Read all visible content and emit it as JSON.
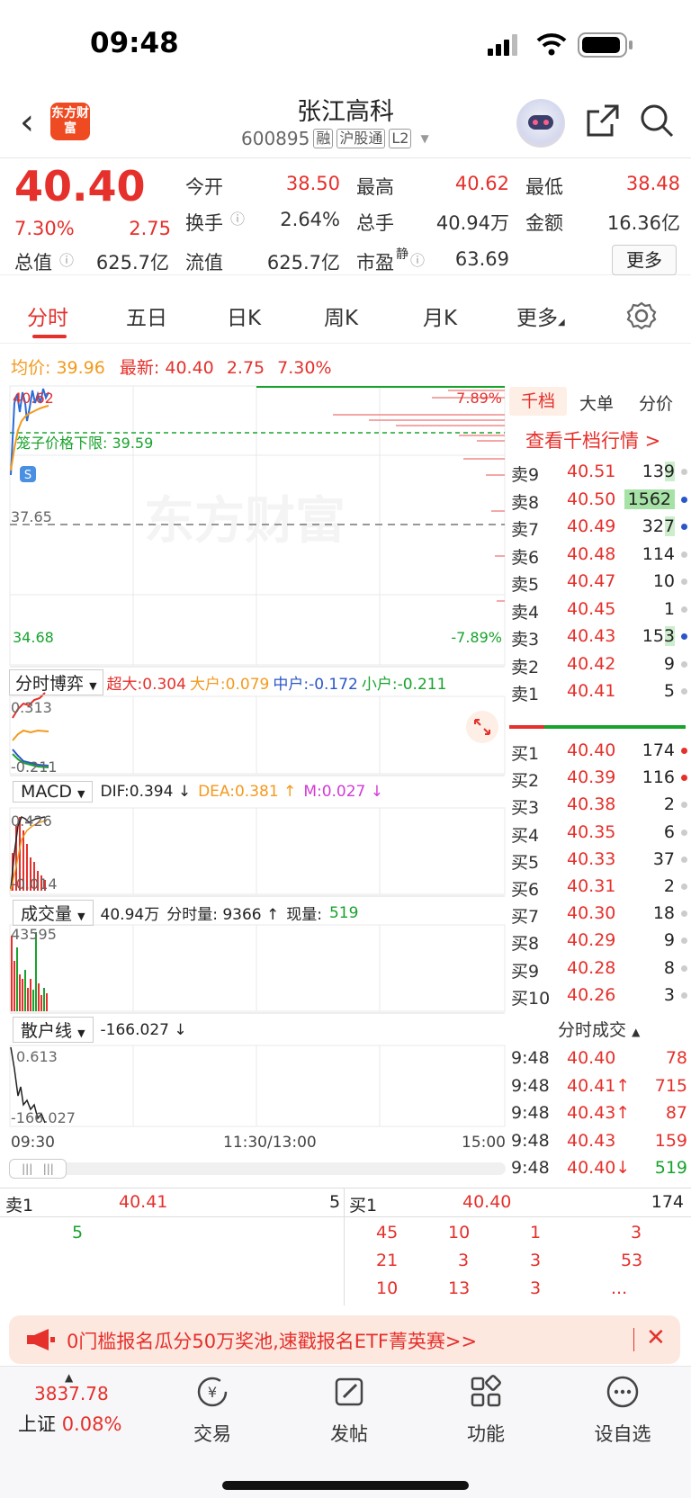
{
  "status_bar": {
    "time": "09:48"
  },
  "header": {
    "logo_text": "东方财富",
    "stock_name": "张江高科",
    "stock_code": "600895",
    "tags": [
      "融",
      "沪股通",
      "L2"
    ]
  },
  "quote": {
    "price": "40.40",
    "change_pct": "7.30%",
    "change": "2.75",
    "fields": [
      {
        "label": "今开",
        "value": "38.50",
        "color": "red"
      },
      {
        "label": "最高",
        "value": "40.62",
        "color": "red"
      },
      {
        "label": "最低",
        "value": "38.48",
        "color": "red"
      },
      {
        "label": "换手",
        "value": "2.64%",
        "color": "dark"
      },
      {
        "label": "总手",
        "value": "40.94万",
        "color": "dark"
      },
      {
        "label": "金额",
        "value": "16.36亿",
        "color": "dark"
      },
      {
        "label": "总值",
        "value": "625.7亿",
        "color": "dark"
      },
      {
        "label": "流值",
        "value": "625.7亿",
        "color": "dark"
      },
      {
        "label": "市盈",
        "value": "63.69",
        "color": "dark"
      }
    ],
    "pe_sup": "静",
    "more_label": "更多"
  },
  "tabs": [
    "分时",
    "五日",
    "日K",
    "周K",
    "月K",
    "更多"
  ],
  "avg_line": {
    "avg_label": "均价:",
    "avg_value": "39.96",
    "latest_label": "最新:",
    "latest_value": "40.40",
    "change": "2.75",
    "change_pct": "7.30%"
  },
  "main_chart": {
    "high_label": "40.62",
    "low_label": "34.68",
    "mid_label": "37.65",
    "up_pct": "7.89%",
    "down_pct": "-7.89%",
    "limit_label": "笼子价格下限: 39.59",
    "s_marker": "S",
    "watermark": "东方财富"
  },
  "capital": {
    "title": "分时博弈",
    "items": [
      {
        "label": "超大:0.304",
        "color": "#e5302b"
      },
      {
        "label": "大户:0.079",
        "color": "#f39a1e"
      },
      {
        "label": "中户:-0.172",
        "color": "#2b56c8"
      },
      {
        "label": "小户:-0.211",
        "color": "#18a32d"
      }
    ],
    "top": "0.313",
    "bottom": "-0.211"
  },
  "macd": {
    "title": "MACD",
    "dif": "DIF:0.394 ↓",
    "dea": "DEA:0.381 ↑",
    "m": "M:0.027 ↓",
    "top": "0.426",
    "bottom": "-0.014"
  },
  "volume": {
    "title": "成交量",
    "total": "40.94万",
    "label": "分时量: 9366 ↑",
    "now_label": "现量:",
    "now_value": "519",
    "top": "43595"
  },
  "retail": {
    "title": "散户线",
    "value": "-166.027 ↓",
    "top": "0.613",
    "bottom": "-166.027"
  },
  "time_axis": [
    "09:30",
    "11:30/13:00",
    "15:00"
  ],
  "orderbook": {
    "tabs": [
      "千档",
      "大单",
      "分价"
    ],
    "link": "查看千档行情 >",
    "asks": [
      {
        "label": "卖9",
        "price": "40.51",
        "vol": "139",
        "dot": "#ccc"
      },
      {
        "label": "卖8",
        "price": "40.50",
        "vol": "1562",
        "dot": "#2b56c8"
      },
      {
        "label": "卖7",
        "price": "40.49",
        "vol": "327",
        "dot": "#2b56c8"
      },
      {
        "label": "卖6",
        "price": "40.48",
        "vol": "114",
        "dot": "#ccc"
      },
      {
        "label": "卖5",
        "price": "40.47",
        "vol": "10",
        "dot": "#ccc"
      },
      {
        "label": "卖4",
        "price": "40.45",
        "vol": "1",
        "dot": "#ccc"
      },
      {
        "label": "卖3",
        "price": "40.43",
        "vol": "153",
        "dot": "#2b56c8"
      },
      {
        "label": "卖2",
        "price": "40.42",
        "vol": "9",
        "dot": "#ccc"
      },
      {
        "label": "卖1",
        "price": "40.41",
        "vol": "5",
        "dot": "#ccc"
      }
    ],
    "bids": [
      {
        "label": "买1",
        "price": "40.40",
        "vol": "174",
        "dot": "#e5302b"
      },
      {
        "label": "买2",
        "price": "40.39",
        "vol": "116",
        "dot": "#e5302b"
      },
      {
        "label": "买3",
        "price": "40.38",
        "vol": "2",
        "dot": "#ccc"
      },
      {
        "label": "买4",
        "price": "40.35",
        "vol": "6",
        "dot": "#ccc"
      },
      {
        "label": "买5",
        "price": "40.33",
        "vol": "37",
        "dot": "#ccc"
      },
      {
        "label": "买6",
        "price": "40.31",
        "vol": "2",
        "dot": "#ccc"
      },
      {
        "label": "买7",
        "price": "40.30",
        "vol": "18",
        "dot": "#ccc"
      },
      {
        "label": "买8",
        "price": "40.29",
        "vol": "9",
        "dot": "#ccc"
      },
      {
        "label": "买9",
        "price": "40.28",
        "vol": "8",
        "dot": "#ccc"
      },
      {
        "label": "买10",
        "price": "40.26",
        "vol": "3",
        "dot": "#ccc"
      }
    ],
    "trades_title": "分时成交",
    "trades": [
      {
        "time": "9:48",
        "price": "40.40",
        "vol": "78",
        "pc": "red",
        "vc": "red"
      },
      {
        "time": "9:48",
        "price": "40.41↑",
        "vol": "715",
        "pc": "red",
        "vc": "red"
      },
      {
        "time": "9:48",
        "price": "40.43↑",
        "vol": "87",
        "pc": "red",
        "vc": "red"
      },
      {
        "time": "9:48",
        "price": "40.43",
        "vol": "159",
        "pc": "red",
        "vc": "red"
      },
      {
        "time": "9:48",
        "price": "40.40↓",
        "vol": "519",
        "pc": "red",
        "vc": "green"
      }
    ]
  },
  "queue": {
    "sell_label": "卖1",
    "sell_price": "40.41",
    "sell_vol": "5",
    "buy_label": "买1",
    "buy_price": "40.40",
    "buy_vol": "174",
    "sell_orders": [
      "5"
    ],
    "buy_orders": [
      [
        "45",
        "10",
        "1",
        "3"
      ],
      [
        "21",
        "3",
        "3",
        "53"
      ],
      [
        "10",
        "13",
        "3",
        "..."
      ]
    ]
  },
  "banner": {
    "text": "0门槛报名瓜分50万奖池,速戳报名ETF菁英赛>>"
  },
  "bottom_nav": {
    "index_value": "3837.78",
    "index_name": "上证",
    "index_pct": "0.08%",
    "items": [
      "交易",
      "发帖",
      "功能",
      "设自选"
    ]
  }
}
